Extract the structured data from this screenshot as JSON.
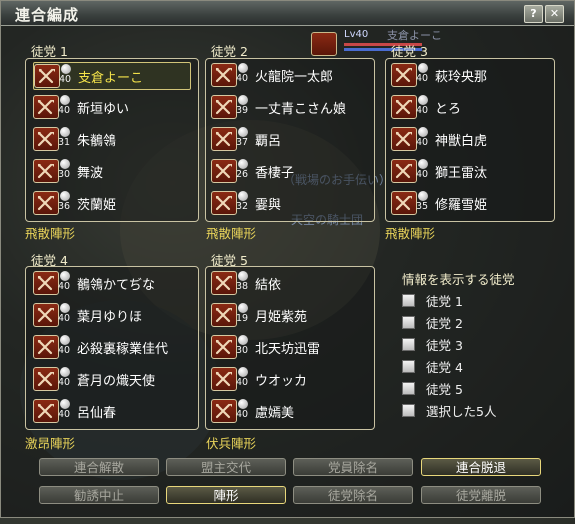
{
  "window": {
    "title": "連合編成"
  },
  "title_buttons": {
    "help": "?",
    "close": "✕"
  },
  "top_status": {
    "level_text": "Lv40",
    "name": "支倉よーこ"
  },
  "groups": [
    {
      "label": "徒党 1",
      "formation": "飛散陣形",
      "members": [
        {
          "level": "40",
          "name": "支倉よーこ",
          "selected": true
        },
        {
          "level": "40",
          "name": "新垣ゆい"
        },
        {
          "level": "31",
          "name": "朱鶺鴒"
        },
        {
          "level": "30",
          "name": "舞波"
        },
        {
          "level": "36",
          "name": "茨蘭姫"
        }
      ]
    },
    {
      "label": "徒党 2",
      "formation": "飛散陣形",
      "members": [
        {
          "level": "40",
          "name": "火龍院一太郎"
        },
        {
          "level": "39",
          "name": "一丈青こさん娘"
        },
        {
          "level": "37",
          "name": "覇呂"
        },
        {
          "level": "26",
          "name": "香棲子"
        },
        {
          "level": "32",
          "name": "霎與"
        }
      ]
    },
    {
      "label": "徒党 3",
      "formation": "飛散陣形",
      "members": [
        {
          "level": "40",
          "name": "萩玲央那"
        },
        {
          "level": "40",
          "name": "とろ"
        },
        {
          "level": "40",
          "name": "神獣白虎"
        },
        {
          "level": "40",
          "name": "獅王雷汰"
        },
        {
          "level": "35",
          "name": "修羅雪姫"
        }
      ]
    },
    {
      "label": "徒党 4",
      "formation": "激昂陣形",
      "members": [
        {
          "level": "40",
          "name": "鶺鴒かてぢな"
        },
        {
          "level": "40",
          "name": "葉月ゆりほ"
        },
        {
          "level": "40",
          "name": "必殺裏稼業佳代"
        },
        {
          "level": "40",
          "name": "蒼月の熾天使"
        },
        {
          "level": "40",
          "name": "呂仙春"
        }
      ]
    },
    {
      "label": "徒党 5",
      "formation": "伏兵陣形",
      "members": [
        {
          "level": "38",
          "name": "結依"
        },
        {
          "level": "19",
          "name": "月姫紫苑"
        },
        {
          "level": "30",
          "name": "北天坊迅雷"
        },
        {
          "level": "40",
          "name": "ウオッカ"
        },
        {
          "level": "40",
          "name": "慮嫣美"
        }
      ]
    }
  ],
  "info_panel": {
    "title": "情報を表示する徒党",
    "options": [
      {
        "label": "徒党 1",
        "checked": false
      },
      {
        "label": "徒党 2",
        "checked": false
      },
      {
        "label": "徒党 3",
        "checked": false
      },
      {
        "label": "徒党 4",
        "checked": false
      },
      {
        "label": "徒党 5",
        "checked": false
      },
      {
        "label": "選択した5人",
        "checked": false
      }
    ]
  },
  "buttons_row1": [
    {
      "label": "連合解散",
      "active": false
    },
    {
      "label": "盟主交代",
      "active": false
    },
    {
      "label": "党員除名",
      "active": false
    },
    {
      "label": "連合脱退",
      "active": true
    }
  ],
  "buttons_row2": [
    {
      "label": "勧誘中止",
      "active": false
    },
    {
      "label": "陣形",
      "active": true
    },
    {
      "label": "徒党除名",
      "active": false
    },
    {
      "label": "徒党離脱",
      "active": false
    }
  ],
  "colors": {
    "accent_gold": "#e8d35a",
    "selected_name": "#f3e24a",
    "icon_red": "#8a2a14"
  },
  "icons": {
    "member": "crossed-swords-icon",
    "status": "status-dot-icon"
  }
}
